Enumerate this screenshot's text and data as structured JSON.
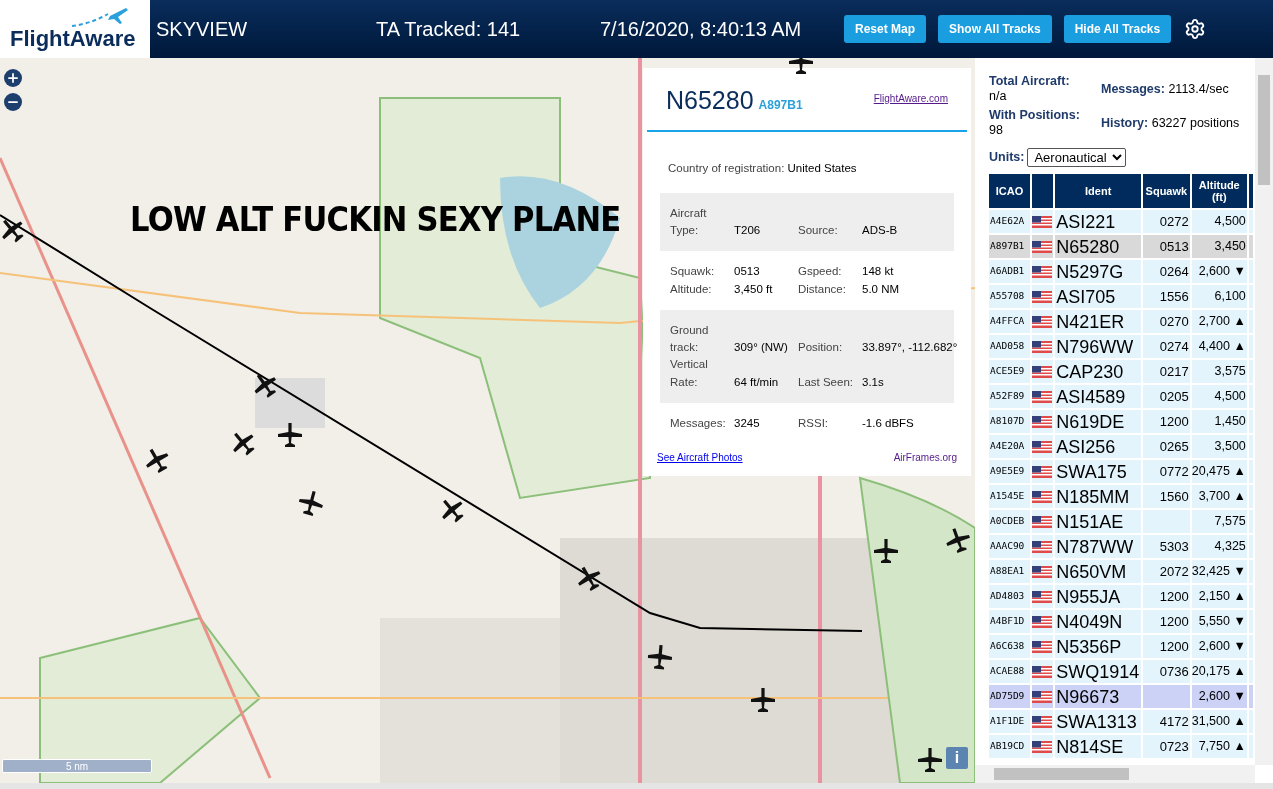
{
  "header": {
    "logo": "FlightAware",
    "title": "SKYVIEW",
    "tracked": "TA Tracked: 141",
    "datetime": "7/16/2020, 8:40:13 AM",
    "buttons": [
      "Reset Map",
      "Show All Tracks",
      "Hide All Tracks"
    ]
  },
  "map": {
    "caption": "LOW ALT FUCKIN SEXY PLANE",
    "scale": "5 nm",
    "info_button": "i"
  },
  "popup": {
    "ident": "N65280",
    "icao": "A897B1",
    "link": "FlightAware.com",
    "country_label": "Country of registration:",
    "country": "United States",
    "sections": [
      {
        "shaded": true,
        "fields": [
          {
            "label": "Aircraft Type:",
            "value": "T206"
          },
          {
            "label": "Source:",
            "value": "ADS-B"
          }
        ]
      },
      {
        "shaded": false,
        "fields": [
          {
            "label": "Squawk:",
            "value": "0513"
          },
          {
            "label": "Gspeed:",
            "value": "148 kt"
          },
          {
            "label": "Altitude:",
            "value": "3,450 ft"
          },
          {
            "label": "Distance:",
            "value": "5.0 NM"
          }
        ]
      },
      {
        "shaded": true,
        "fields": [
          {
            "label": "Ground track:",
            "value": "309° (NW)"
          },
          {
            "label": "Position:",
            "value": "33.897°, -112.682°"
          },
          {
            "label": "Vertical Rate:",
            "value": "64 ft/min"
          },
          {
            "label": "Last Seen:",
            "value": "3.1s"
          }
        ]
      },
      {
        "shaded": false,
        "fields": [
          {
            "label": "Messages:",
            "value": "3245"
          },
          {
            "label": "RSSI:",
            "value": "-1.6 dBFS"
          }
        ]
      }
    ],
    "photos_link": "See Aircraft Photos",
    "airframes_link": "AirFrames.org"
  },
  "stats": [
    {
      "label": "Total Aircraft:",
      "value": "n/a"
    },
    {
      "label": "Messages:",
      "value": "2113.4/sec"
    },
    {
      "label": "With Positions:",
      "value": "98"
    },
    {
      "label": "History:",
      "value": "63227 positions"
    }
  ],
  "units": {
    "label": "Units:",
    "value": "Aeronautical"
  },
  "table": {
    "columns": [
      "ICAO",
      "Ident",
      "Squawk",
      "Altitude (ft)"
    ],
    "rows": [
      {
        "icao": "A4E62A",
        "ident": "ASI221",
        "squawk": "0272",
        "altitude": "4,500",
        "selected": false,
        "highlighted": false
      },
      {
        "icao": "A897B1",
        "ident": "N65280",
        "squawk": "0513",
        "altitude": "3,450",
        "selected": true,
        "highlighted": false
      },
      {
        "icao": "A6ADB1",
        "ident": "N5297G",
        "squawk": "0264",
        "altitude": "2,600 ▼",
        "selected": false,
        "highlighted": false
      },
      {
        "icao": "A55708",
        "ident": "ASI705",
        "squawk": "1556",
        "altitude": "6,100",
        "selected": false,
        "highlighted": false
      },
      {
        "icao": "A4FFCA",
        "ident": "N421ER",
        "squawk": "0270",
        "altitude": "2,700 ▲",
        "selected": false,
        "highlighted": false
      },
      {
        "icao": "AAD058",
        "ident": "N796WW",
        "squawk": "0274",
        "altitude": "4,400 ▲",
        "selected": false,
        "highlighted": false
      },
      {
        "icao": "ACE5E9",
        "ident": "CAP230",
        "squawk": "0217",
        "altitude": "3,575",
        "selected": false,
        "highlighted": false
      },
      {
        "icao": "A52F89",
        "ident": "ASI4589",
        "squawk": "0205",
        "altitude": "4,500",
        "selected": false,
        "highlighted": false
      },
      {
        "icao": "A8107D",
        "ident": "N619DE",
        "squawk": "1200",
        "altitude": "1,450",
        "selected": false,
        "highlighted": false
      },
      {
        "icao": "A4E20A",
        "ident": "ASI256",
        "squawk": "0265",
        "altitude": "3,500",
        "selected": false,
        "highlighted": false
      },
      {
        "icao": "A9E5E9",
        "ident": "SWA175",
        "squawk": "0772",
        "altitude": "20,475 ▲",
        "selected": false,
        "highlighted": false
      },
      {
        "icao": "A1545E",
        "ident": "N185MM",
        "squawk": "1560",
        "altitude": "3,700 ▲",
        "selected": false,
        "highlighted": false
      },
      {
        "icao": "A0CDEB",
        "ident": "N151AE",
        "altitude": "7,575",
        "selected": false,
        "highlighted": false
      },
      {
        "icao": "AAAC90",
        "ident": "N787WW",
        "squawk": "5303",
        "altitude": "4,325",
        "selected": false,
        "highlighted": false
      },
      {
        "icao": "A88EA1",
        "ident": "N650VM",
        "squawk": "2072",
        "altitude": "32,425 ▼",
        "selected": false,
        "highlighted": false
      },
      {
        "icao": "AD4803",
        "ident": "N955JA",
        "squawk": "1200",
        "altitude": "2,150 ▲",
        "selected": false,
        "highlighted": false
      },
      {
        "icao": "A4BF1D",
        "ident": "N4049N",
        "squawk": "1200",
        "altitude": "5,550 ▼",
        "selected": false,
        "highlighted": false
      },
      {
        "icao": "A6C638",
        "ident": "N5356P",
        "squawk": "1200",
        "altitude": "2,600 ▼",
        "selected": false,
        "highlighted": false
      },
      {
        "icao": "ACAE88",
        "ident": "SWQ1914",
        "squawk": "0736",
        "altitude": "20,175 ▲",
        "selected": false,
        "highlighted": false
      },
      {
        "icao": "AD75D9",
        "ident": "N96673",
        "altitude": "2,600 ▼",
        "selected": false,
        "highlighted": true
      },
      {
        "icao": "A1F1DE",
        "ident": "SWA1313",
        "squawk": "4172",
        "altitude": "31,500 ▲",
        "selected": false,
        "highlighted": false
      },
      {
        "icao": "AB19CD",
        "ident": "N814SE",
        "squawk": "0723",
        "altitude": "7,750 ▲",
        "selected": false,
        "highlighted": false
      }
    ]
  }
}
